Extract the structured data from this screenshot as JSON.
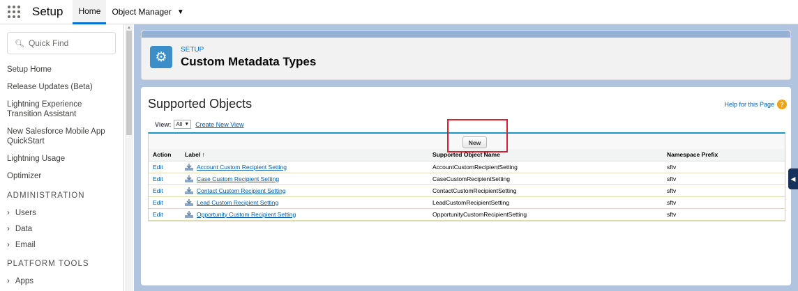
{
  "topbar": {
    "app_name": "Setup",
    "tabs": [
      {
        "label": "Home"
      },
      {
        "label": "Object Manager"
      }
    ]
  },
  "sidebar": {
    "search_placeholder": "Quick Find",
    "items": [
      {
        "label": "Setup Home"
      },
      {
        "label": "Release Updates (Beta)"
      },
      {
        "label": "Lightning Experience Transition Assistant"
      },
      {
        "label": "New Salesforce Mobile App QuickStart"
      },
      {
        "label": "Lightning Usage"
      },
      {
        "label": "Optimizer"
      }
    ],
    "section_admin": "ADMINISTRATION",
    "admin_items": [
      {
        "label": "Users"
      },
      {
        "label": "Data"
      },
      {
        "label": "Email"
      }
    ],
    "section_platform": "PLATFORM TOOLS",
    "platform_items": [
      {
        "label": "Apps"
      }
    ]
  },
  "header": {
    "eyebrow": "SETUP",
    "title": "Custom Metadata Types"
  },
  "content": {
    "title": "Supported Objects",
    "help_link": "Help for this Page",
    "view_label": "View:",
    "view_value": "All",
    "create_view": "Create New View",
    "new_button": "New",
    "columns": [
      "Action",
      "Label",
      "Supported Object Name",
      "Namespace Prefix"
    ],
    "sort_indicator": "↑",
    "rows": [
      {
        "action": "Edit",
        "label": "Account Custom Recipient Setting",
        "object_name": "AccountCustomRecipientSetting",
        "prefix": "sftv"
      },
      {
        "action": "Edit",
        "label": "Case Custom Recipient Setting",
        "object_name": "CaseCustomRecipientSetting",
        "prefix": "sftv"
      },
      {
        "action": "Edit",
        "label": "Contact Custom Recipient Setting",
        "object_name": "ContactCustomRecipientSetting",
        "prefix": "sftv"
      },
      {
        "action": "Edit",
        "label": "Lead Custom Recipient Setting",
        "object_name": "LeadCustomRecipientSetting",
        "prefix": "sftv"
      },
      {
        "action": "Edit",
        "label": "Opportunity Custom Recipient Setting",
        "object_name": "OpportunityCustomRecipientSetting",
        "prefix": "sftv"
      }
    ]
  },
  "colors": {
    "brand_blue": "#0070d2",
    "link_blue": "#015ba7",
    "highlight_red": "#d9202f",
    "table_accent": "#1797c0"
  }
}
